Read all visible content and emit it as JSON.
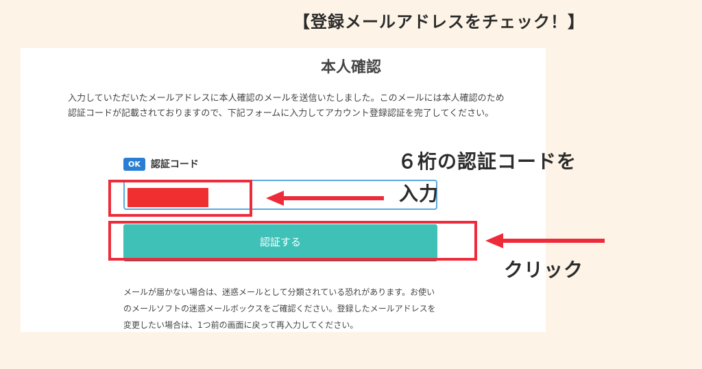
{
  "headline": "【登録メールアドレスをチェック！】",
  "panel": {
    "title": "本人確認",
    "intro": "入力していただいたメールアドレスに本人確認のメールを送信いたしました。このメールには本人確認のため認証コードが記載されておりますので、下記フォームに入力してアカウント登録認証を完了してください。",
    "field": {
      "badge": "OK",
      "label": "認証コード"
    },
    "submit_label": "認証する",
    "notice": "メールが届かない場合は、迷惑メールとして分類されている恐れがあります。お使いのメールソフトの迷惑メールボックスをご確認ください。登録したメールアドレスを変更したい場合は、1つ前の画面に戻って再入力してください。"
  },
  "annotations": {
    "input_hint_line1": "６桁の認証コードを",
    "input_hint_line2": "入力",
    "click_hint": "クリック"
  },
  "colors": {
    "highlight": "#ee2b3a",
    "button": "#3fc1b8",
    "input_border": "#5aa8df",
    "badge": "#2a7fd4"
  }
}
